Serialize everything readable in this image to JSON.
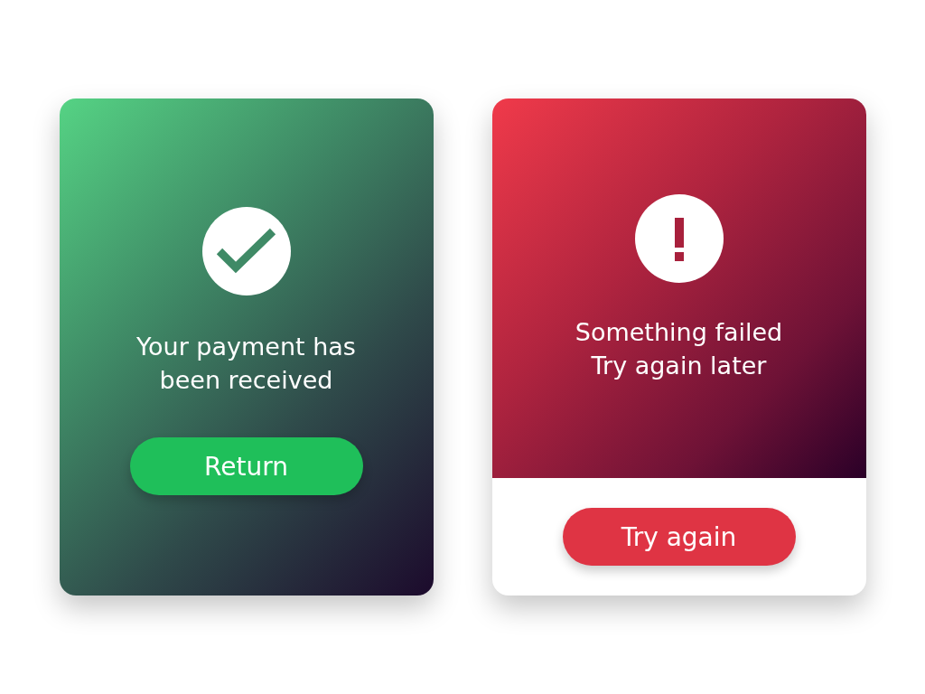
{
  "cards": [
    {
      "kind": "success",
      "message_lines": [
        "Your payment has",
        "been received"
      ],
      "button": "Return"
    },
    {
      "kind": "error",
      "message_lines": [
        "Something failed",
        "Try again later"
      ],
      "button": "Try again"
    }
  ]
}
